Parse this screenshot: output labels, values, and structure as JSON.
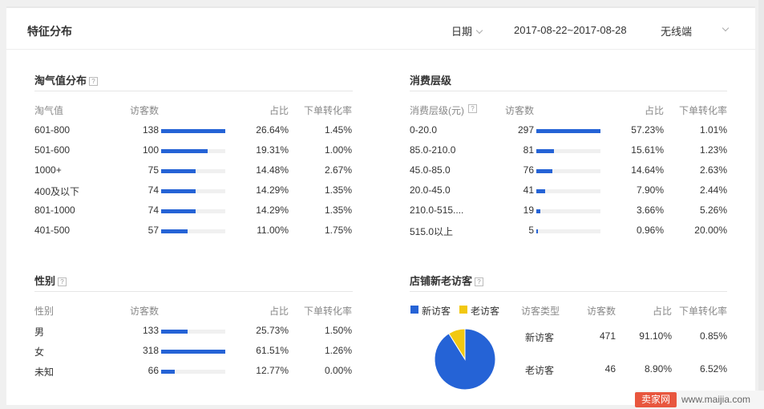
{
  "header": {
    "title": "特征分布",
    "date_label": "日期",
    "date_range": "2017-08-22~2017-08-28",
    "device": "无线端"
  },
  "taoqi": {
    "title": "淘气值分布",
    "help": "?",
    "columns": [
      "淘气值",
      "访客数",
      "占比",
      "下单转化率"
    ],
    "rows": [
      {
        "label": "601-800",
        "visitors": "138",
        "share": "26.64%",
        "conv": "1.45%",
        "bar": 1.0
      },
      {
        "label": "501-600",
        "visitors": "100",
        "share": "19.31%",
        "conv": "1.00%",
        "bar": 0.725
      },
      {
        "label": "1000+",
        "visitors": "75",
        "share": "14.48%",
        "conv": "2.67%",
        "bar": 0.543
      },
      {
        "label": "400及以下",
        "visitors": "74",
        "share": "14.29%",
        "conv": "1.35%",
        "bar": 0.536
      },
      {
        "label": "801-1000",
        "visitors": "74",
        "share": "14.29%",
        "conv": "1.35%",
        "bar": 0.536
      },
      {
        "label": "401-500",
        "visitors": "57",
        "share": "11.00%",
        "conv": "1.75%",
        "bar": 0.413
      }
    ]
  },
  "consume": {
    "title": "消费层级",
    "columns": [
      "消费层级(元)",
      "访客数",
      "占比",
      "下单转化率"
    ],
    "help": "?",
    "rows": [
      {
        "label": "0-20.0",
        "visitors": "297",
        "share": "57.23%",
        "conv": "1.01%",
        "bar": 1.0
      },
      {
        "label": "85.0-210.0",
        "visitors": "81",
        "share": "15.61%",
        "conv": "1.23%",
        "bar": 0.273
      },
      {
        "label": "45.0-85.0",
        "visitors": "76",
        "share": "14.64%",
        "conv": "2.63%",
        "bar": 0.256
      },
      {
        "label": "20.0-45.0",
        "visitors": "41",
        "share": "7.90%",
        "conv": "2.44%",
        "bar": 0.138
      },
      {
        "label": "210.0-515....",
        "visitors": "19",
        "share": "3.66%",
        "conv": "5.26%",
        "bar": 0.064
      },
      {
        "label": "515.0以上",
        "visitors": "5",
        "share": "0.96%",
        "conv": "20.00%",
        "bar": 0.017
      }
    ]
  },
  "gender": {
    "title": "性别",
    "help": "?",
    "columns": [
      "性别",
      "访客数",
      "占比",
      "下单转化率"
    ],
    "rows": [
      {
        "label": "男",
        "visitors": "133",
        "share": "25.73%",
        "conv": "1.50%",
        "bar": 0.418
      },
      {
        "label": "女",
        "visitors": "318",
        "share": "61.51%",
        "conv": "1.26%",
        "bar": 1.0
      },
      {
        "label": "未知",
        "visitors": "66",
        "share": "12.77%",
        "conv": "0.00%",
        "bar": 0.208
      }
    ]
  },
  "newold": {
    "title": "店铺新老访客",
    "help": "?",
    "legend": [
      {
        "label": "新访客",
        "color": "#2563d6"
      },
      {
        "label": "老访客",
        "color": "#f2c811"
      }
    ],
    "columns": [
      "访客类型",
      "访客数",
      "占比",
      "下单转化率"
    ],
    "rows": [
      {
        "label": "新访客",
        "visitors": "471",
        "share": "91.10%",
        "conv": "0.85%"
      },
      {
        "label": "老访客",
        "visitors": "46",
        "share": "8.90%",
        "conv": "6.52%"
      }
    ]
  },
  "chart_data": {
    "type": "pie",
    "categories": [
      "新访客",
      "老访客"
    ],
    "values": [
      91.1,
      8.9
    ],
    "colors": [
      "#2563d6",
      "#f2c811"
    ]
  },
  "watermark": {
    "badge": "卖家网",
    "url": "www.maijia.com"
  },
  "colors": {
    "bar": "#2563d6",
    "bar_track": "#f0f0f0"
  }
}
